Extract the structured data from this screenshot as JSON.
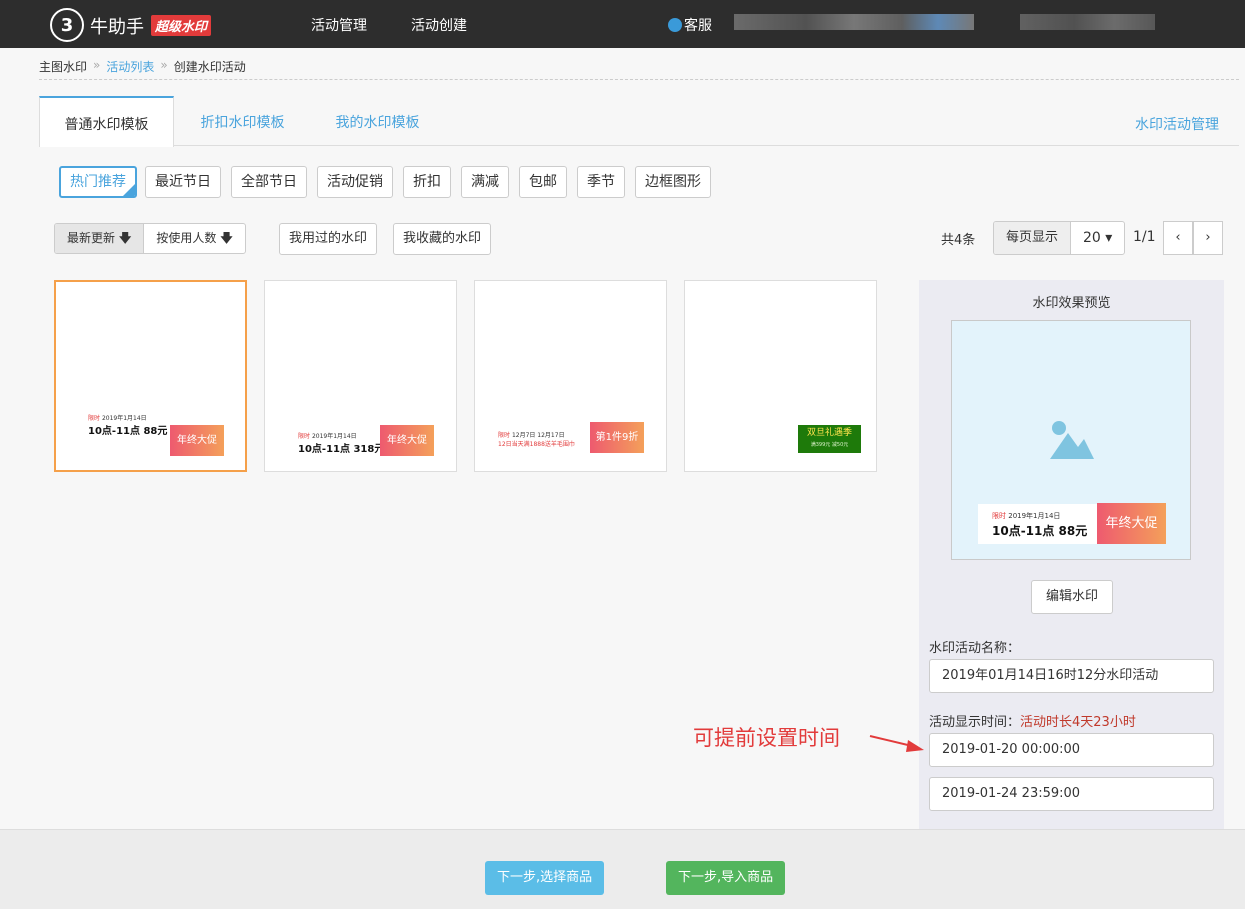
{
  "header": {
    "logo_glyph": "3",
    "brand": "牛助手",
    "badge": "超级水印",
    "nav": [
      "活动管理",
      "活动创建"
    ],
    "service": "客服"
  },
  "breadcrumb": [
    "主图水印",
    "活动列表",
    "创建水印活动"
  ],
  "tabs": [
    "普通水印模板",
    "折扣水印模板",
    "我的水印模板"
  ],
  "tab_manage": "水印活动管理",
  "categories": [
    "热门推荐",
    "最近节日",
    "全部节日",
    "活动促销",
    "折扣",
    "满减",
    "包邮",
    "季节",
    "边框图形"
  ],
  "sort": {
    "latest": "最新更新",
    "by_users": "按使用人数",
    "arrow": "🡇"
  },
  "filters": {
    "used": "我用过的水印",
    "favorites": "我收藏的水印"
  },
  "pagination": {
    "total": "共4条",
    "per_page_label": "每页显示",
    "per_page": "20",
    "page": "1/1",
    "prev": "‹",
    "next": "›"
  },
  "cards": [
    {
      "tag": "限时",
      "line1": "2019年1月14日",
      "big": "10点-11点 88元",
      "badge": "年终大促"
    },
    {
      "tag": "限时",
      "line1": "2019年1月14日",
      "big": "10点-11点 318元",
      "badge": "年终大促"
    },
    {
      "tag": "限时",
      "line1": "12月7日 12月17日",
      "line2": "12日当天满1888送羊毛围巾",
      "badge": "第1件9折"
    },
    {
      "green_title": "双旦礼遇季",
      "green_sub": "满399元 减50元"
    }
  ],
  "preview": {
    "title": "水印效果预览",
    "tag": "限时",
    "line1": "2019年1月14日",
    "big": "10点-11点 88元",
    "badge": "年终大促",
    "edit": "编辑水印",
    "name_label": "水印活动名称：",
    "name_value": "2019年01月14日16时12分水印活动",
    "time_label": "活动显示时间：",
    "duration": "活动时长4天23小时",
    "start": "2019-01-20 00:00:00",
    "end": "2019-01-24 23:59:00"
  },
  "annotation": "可提前设置时间",
  "footer": {
    "next_select": "下一步,选择商品",
    "next_import": "下一步,导入商品"
  },
  "colors": {
    "accent": "#4aa4dd",
    "topbar": "#2d2d2d",
    "selected": "#f5a04a",
    "red": "#e23b3b",
    "green": "#53b55d"
  }
}
